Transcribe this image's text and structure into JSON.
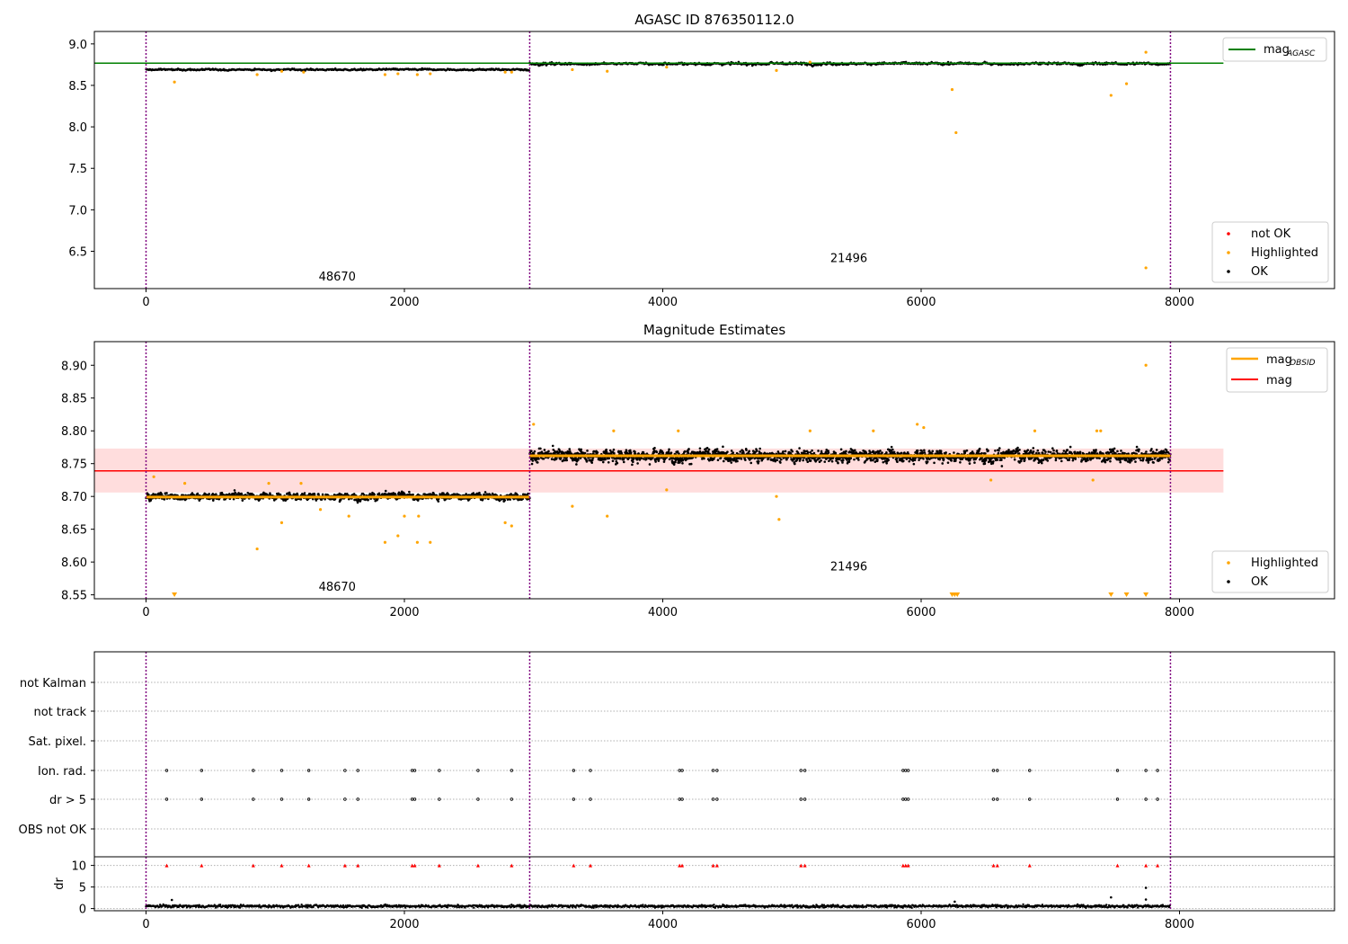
{
  "chart_data": [
    {
      "type": "scatter",
      "title": "AGASC ID 876350112.0",
      "xlim": [
        -400,
        9200
      ],
      "ylim": [
        6.05,
        9.15
      ],
      "xticks": [
        "0",
        "2000",
        "4000",
        "6000",
        "8000"
      ],
      "xtick_values": [
        0,
        2000,
        4000,
        6000,
        8000
      ],
      "yticks": [
        "6.5",
        "7.0",
        "7.5",
        "8.0",
        "8.5",
        "9.0"
      ],
      "ytick_values": [
        6.5,
        7.0,
        7.5,
        8.0,
        8.5,
        9.0
      ],
      "obs_boundaries": [
        0,
        2970,
        7930
      ],
      "obs_labels": [
        {
          "text": "48670",
          "x": 1480,
          "y": 6.15
        },
        {
          "text": "21496",
          "x": 5440,
          "y": 6.37
        }
      ],
      "reference_lines": [
        {
          "name": "mag",
          "subscript": "AGASC",
          "y": 8.768,
          "x": [
            -400,
            8340
          ],
          "color": "#008000"
        }
      ],
      "segments": [
        {
          "x": [
            0,
            2970
          ],
          "level": 8.69,
          "spread": 0.012
        },
        {
          "x": [
            2970,
            7930
          ],
          "level": 8.762,
          "spread": 0.018
        }
      ],
      "highlighted_points": [
        [
          220,
          8.54
        ],
        [
          860,
          8.63
        ],
        [
          1050,
          8.67
        ],
        [
          1220,
          8.66
        ],
        [
          1850,
          8.63
        ],
        [
          1950,
          8.64
        ],
        [
          2100,
          8.63
        ],
        [
          2200,
          8.64
        ],
        [
          2780,
          8.66
        ],
        [
          2830,
          8.66
        ],
        [
          3300,
          8.69
        ],
        [
          3570,
          8.67
        ],
        [
          4030,
          8.72
        ],
        [
          4880,
          8.68
        ],
        [
          5140,
          8.78
        ],
        [
          6240,
          8.45
        ],
        [
          6270,
          7.93
        ],
        [
          7470,
          8.38
        ],
        [
          7590,
          8.52
        ],
        [
          7740,
          6.3
        ],
        [
          7740,
          8.9
        ]
      ],
      "legends": [
        {
          "position": "upper-right",
          "entries": [
            {
              "label": "mag",
              "subscript": "AGASC",
              "marker": "line",
              "color": "#008000"
            }
          ]
        },
        {
          "position": "lower-right",
          "entries": [
            {
              "label": "not OK",
              "marker": "dot",
              "color": "#ff0000"
            },
            {
              "label": "Highlighted",
              "marker": "dot",
              "color": "#ffa500"
            },
            {
              "label": "OK",
              "marker": "dot",
              "color": "#000000"
            }
          ]
        }
      ]
    },
    {
      "type": "scatter",
      "title": "Magnitude Estimates",
      "xlim": [
        -400,
        9200
      ],
      "ylim": [
        8.544,
        8.936
      ],
      "xticks": [
        "0",
        "2000",
        "4000",
        "6000",
        "8000"
      ],
      "xtick_values": [
        0,
        2000,
        4000,
        6000,
        8000
      ],
      "yticks": [
        "8.55",
        "8.60",
        "8.65",
        "8.70",
        "8.75",
        "8.80",
        "8.85",
        "8.90"
      ],
      "ytick_values": [
        8.55,
        8.6,
        8.65,
        8.7,
        8.75,
        8.8,
        8.85,
        8.9
      ],
      "obs_boundaries": [
        0,
        2970,
        7930
      ],
      "obs_labels": [
        {
          "text": "48670",
          "x": 1480,
          "y": 8.556
        },
        {
          "text": "21496",
          "x": 5440,
          "y": 8.587
        }
      ],
      "mag_band": {
        "x": [
          -400,
          8340
        ],
        "y": [
          8.706,
          8.773
        ],
        "color": "#ffdddd"
      },
      "reference_lines": [
        {
          "name": "mag",
          "y": 8.739,
          "x": [
            -400,
            8340
          ],
          "color": "#ff0000"
        }
      ],
      "obsid_lines": [
        {
          "name": "mag",
          "subscript": "OBSID",
          "x": [
            0,
            2970
          ],
          "y": 8.699,
          "color": "#ffa500"
        },
        {
          "name": "mag",
          "subscript": "OBSID",
          "x": [
            2970,
            7930
          ],
          "y": 8.762,
          "color": "#ffa500"
        }
      ],
      "segments": [
        {
          "x": [
            0,
            2970
          ],
          "level": 8.7,
          "spread": 0.006
        },
        {
          "x": [
            2970,
            7930
          ],
          "level": 8.762,
          "spread": 0.011
        }
      ],
      "highlighted_points": [
        [
          60,
          8.73
        ],
        [
          300,
          8.72
        ],
        [
          860,
          8.62
        ],
        [
          950,
          8.72
        ],
        [
          1050,
          8.66
        ],
        [
          1200,
          8.72
        ],
        [
          1350,
          8.68
        ],
        [
          1570,
          8.67
        ],
        [
          1850,
          8.63
        ],
        [
          1950,
          8.64
        ],
        [
          2000,
          8.67
        ],
        [
          2100,
          8.63
        ],
        [
          2110,
          8.67
        ],
        [
          2200,
          8.63
        ],
        [
          2780,
          8.66
        ],
        [
          2830,
          8.655
        ],
        [
          3000,
          8.81
        ],
        [
          3300,
          8.685
        ],
        [
          3570,
          8.67
        ],
        [
          3620,
          8.8
        ],
        [
          4030,
          8.71
        ],
        [
          4120,
          8.8
        ],
        [
          4880,
          8.7
        ],
        [
          4900,
          8.665
        ],
        [
          5140,
          8.8
        ],
        [
          5630,
          8.8
        ],
        [
          5970,
          8.81
        ],
        [
          6020,
          8.805
        ],
        [
          6540,
          8.725
        ],
        [
          6880,
          8.8
        ],
        [
          7330,
          8.725
        ],
        [
          7360,
          8.8
        ],
        [
          7390,
          8.8
        ],
        [
          7740,
          8.9
        ]
      ],
      "clipped_points_x": [
        220,
        6240,
        6260,
        6280,
        7470,
        7590,
        7740
      ],
      "legends": [
        {
          "position": "upper-right",
          "entries": [
            {
              "label": "mag",
              "subscript": "OBSID",
              "marker": "line",
              "color": "#ffa500"
            },
            {
              "label": "mag",
              "marker": "line",
              "color": "#ff0000"
            }
          ]
        },
        {
          "position": "lower-right",
          "entries": [
            {
              "label": "Highlighted",
              "marker": "dot",
              "color": "#ffa500"
            },
            {
              "label": "OK",
              "marker": "dot",
              "color": "#000000"
            }
          ]
        }
      ]
    },
    {
      "type": "scatter",
      "xlim": [
        -400,
        9200
      ],
      "obs_boundaries": [
        0,
        2970,
        7930
      ],
      "flag_rows": [
        "not Kalman",
        "not track",
        "Sat. pixel.",
        "Ion. rad.",
        "dr > 5",
        "OBS not OK"
      ],
      "flag_events_x": [
        160,
        430,
        830,
        1050,
        1260,
        1540,
        1640,
        2060,
        2080,
        2270,
        2570,
        2830,
        3310,
        3440,
        4130,
        4150,
        4390,
        4420,
        5070,
        5100,
        5860,
        5880,
        5900,
        6560,
        6590,
        6840,
        7520,
        7740,
        7830
      ],
      "flag_events_rows": [
        "Ion. rad.",
        "dr > 5"
      ],
      "dr": {
        "ylabel": "dr",
        "ylim": [
          -0.5,
          12
        ],
        "yticks": [
          "0",
          "5",
          "10"
        ],
        "ytick_values": [
          0,
          5,
          10
        ],
        "baseline": 0.55,
        "outliers": [
          [
            200,
            2.0
          ],
          [
            6260,
            1.6
          ],
          [
            7470,
            2.6
          ],
          [
            7740,
            4.8
          ],
          [
            7740,
            2.1
          ]
        ],
        "marker_color": "#ff0000",
        "marker_level": 10
      },
      "xticks": [
        "0",
        "2000",
        "4000",
        "6000",
        "8000"
      ],
      "xtick_values": [
        0,
        2000,
        4000,
        6000,
        8000
      ]
    }
  ]
}
